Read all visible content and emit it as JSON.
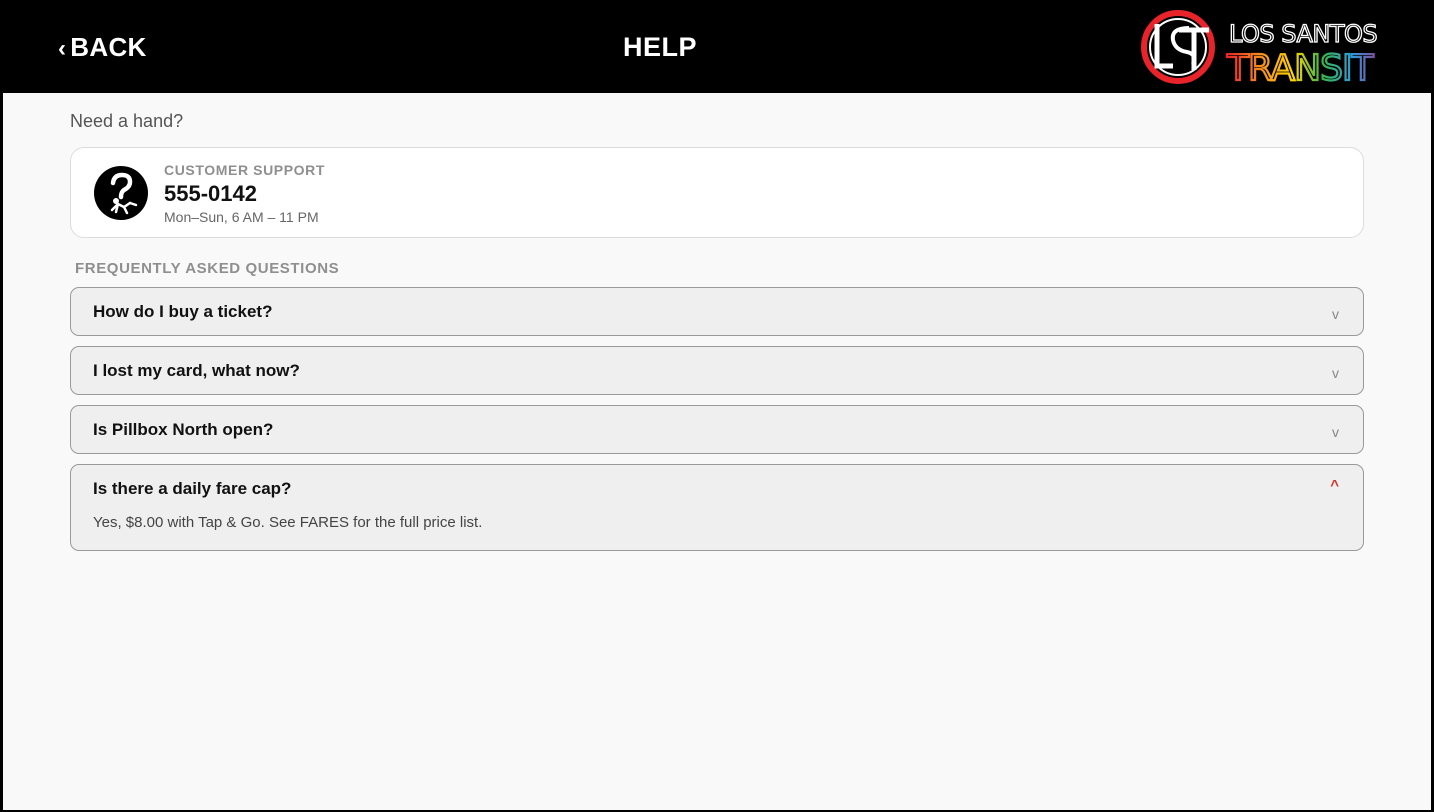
{
  "header": {
    "back_label": "BACK",
    "title": "HELP",
    "logo": {
      "line1": "LOS SANTOS",
      "line2": "TRANSIT",
      "mark": "LST"
    }
  },
  "intro": "Need a hand?",
  "support": {
    "label": "CUSTOMER SUPPORT",
    "phone": "555-0142",
    "hours": "Mon–Sun, 6 AM – 11 PM",
    "icon": "help-person-icon"
  },
  "faq": {
    "heading": "FREQUENTLY ASKED QUESTIONS",
    "items": [
      {
        "question": "How do I buy a ticket?",
        "toggle": "v",
        "expanded": false
      },
      {
        "question": "I lost my card, what now?",
        "toggle": "v",
        "expanded": false
      },
      {
        "question": "Is Pillbox North open?",
        "toggle": "v",
        "expanded": false
      },
      {
        "question": "Is there a daily fare cap?",
        "toggle": "^",
        "expanded": true,
        "answer": "Yes, $8.00 with Tap & Go. See FARES for the full price list."
      }
    ]
  },
  "colors": {
    "header_bg": "#000000",
    "page_bg": "#f9f9f9",
    "accent_red": "#d0342c",
    "logo_rainbow": [
      "#e8232a",
      "#f7941d",
      "#ffd400",
      "#39b54a",
      "#2e9bd6",
      "#7b4fa0"
    ]
  }
}
